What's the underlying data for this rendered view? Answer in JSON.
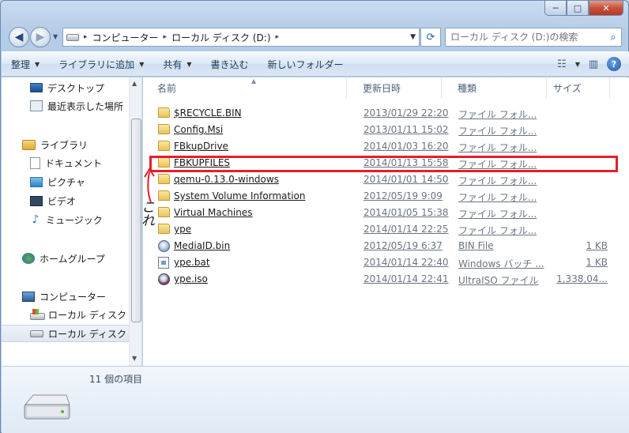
{
  "window": {
    "minimize_glyph": "─",
    "maximize_glyph": "□",
    "close_glyph": "✕"
  },
  "address": {
    "crumbs": [
      "コンピューター",
      "ローカル ディスク (D:)"
    ],
    "separator": "▸",
    "search_placeholder": "ローカル ディスク (D:)の検索"
  },
  "toolbar": {
    "organize": "整理",
    "add_to_library": "ライブラリに追加",
    "share": "共有",
    "burn": "書き込む",
    "new_folder": "新しいフォルダー"
  },
  "nav": {
    "items": [
      {
        "label": "デスクトップ",
        "icon": "desktop-icon"
      },
      {
        "label": "最近表示した場所",
        "icon": "recent-places-icon"
      },
      {
        "label": "ライブラリ",
        "icon": "libraries-icon"
      },
      {
        "label": "ドキュメント",
        "icon": "documents-icon"
      },
      {
        "label": "ピクチャ",
        "icon": "pictures-icon"
      },
      {
        "label": "ビデオ",
        "icon": "videos-icon"
      },
      {
        "label": "ミュージック",
        "icon": "music-icon"
      },
      {
        "label": "ホームグループ",
        "icon": "homegroup-icon"
      },
      {
        "label": "コンピューター",
        "icon": "computer-icon"
      },
      {
        "label": "ローカル ディスク",
        "icon": "windows-drive-icon"
      },
      {
        "label": "ローカル ディスク",
        "icon": "drive-icon"
      }
    ]
  },
  "columns": {
    "name": "名前",
    "date": "更新日時",
    "type": "種類",
    "size": "サイズ"
  },
  "files": [
    {
      "name": "$RECYCLE.BIN",
      "date": "2013/01/29 22:20",
      "type": "ファイル フォル...",
      "size": "",
      "kind": "folder"
    },
    {
      "name": "Config.Msi",
      "date": "2013/01/11 15:02",
      "type": "ファイル フォル...",
      "size": "",
      "kind": "folder"
    },
    {
      "name": "FBkupDrive",
      "date": "2014/01/03 16:20",
      "type": "ファイル フォル...",
      "size": "",
      "kind": "folder"
    },
    {
      "name": "FBKUPFILES",
      "date": "2014/01/13 15:58",
      "type": "ファイル フォル...",
      "size": "",
      "kind": "folder"
    },
    {
      "name": "qemu-0.13.0-windows",
      "date": "2014/01/01 14:50",
      "type": "ファイル フォル...",
      "size": "",
      "kind": "folder"
    },
    {
      "name": "System Volume Information",
      "date": "2012/05/19 9:09",
      "type": "ファイル フォル...",
      "size": "",
      "kind": "folder"
    },
    {
      "name": "Virtual Machines",
      "date": "2014/01/05 15:38",
      "type": "ファイル フォル...",
      "size": "",
      "kind": "folder"
    },
    {
      "name": "ype",
      "date": "2014/01/14 22:25",
      "type": "ファイル フォル...",
      "size": "",
      "kind": "folder"
    },
    {
      "name": "MediaID.bin",
      "date": "2012/05/19 6:37",
      "type": "BIN File",
      "size": "1 KB",
      "kind": "bin"
    },
    {
      "name": "ype.bat",
      "date": "2014/01/14 22:40",
      "type": "Windows バッチ ...",
      "size": "1 KB",
      "kind": "bat"
    },
    {
      "name": "ype.iso",
      "date": "2014/01/14 22:41",
      "type": "UltraISO ファイル",
      "size": "1,338,04...",
      "kind": "iso"
    }
  ],
  "annotation": {
    "text": "これ",
    "color": "#e2202a"
  },
  "status": {
    "count": "11 個の項目"
  }
}
